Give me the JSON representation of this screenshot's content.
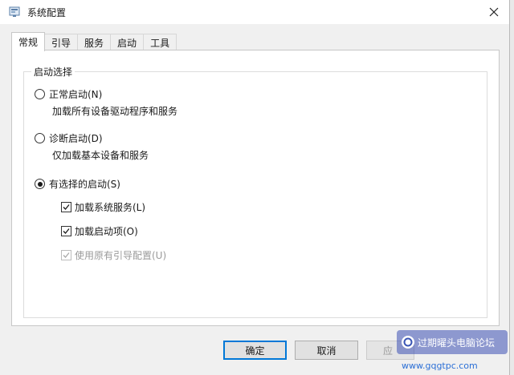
{
  "window": {
    "title": "系统配置",
    "icon": "msconfig-icon"
  },
  "tabs": [
    {
      "label": "常规",
      "active": true
    },
    {
      "label": "引导",
      "active": false
    },
    {
      "label": "服务",
      "active": false
    },
    {
      "label": "启动",
      "active": false
    },
    {
      "label": "工具",
      "active": false
    }
  ],
  "startup_selection": {
    "group_label": "启动选择",
    "normal": {
      "label": "正常启动(N)",
      "desc": "加载所有设备驱动程序和服务",
      "selected": false
    },
    "diagnostic": {
      "label": "诊断启动(D)",
      "desc": "仅加载基本设备和服务",
      "selected": false
    },
    "selective": {
      "label": "有选择的启动(S)",
      "selected": true
    },
    "options": [
      {
        "label": "加载系统服务(L)",
        "checked": true,
        "enabled": true
      },
      {
        "label": "加载启动项(O)",
        "checked": true,
        "enabled": true
      },
      {
        "label": "使用原有引导配置(U)",
        "checked": true,
        "enabled": false
      }
    ]
  },
  "buttons": {
    "ok": "确定",
    "cancel": "取消",
    "apply": "应"
  },
  "watermark": {
    "text": "过期曜头电脑论坛",
    "url": "www.gqgtpc.com"
  },
  "colors": {
    "accent": "#0078d7"
  }
}
